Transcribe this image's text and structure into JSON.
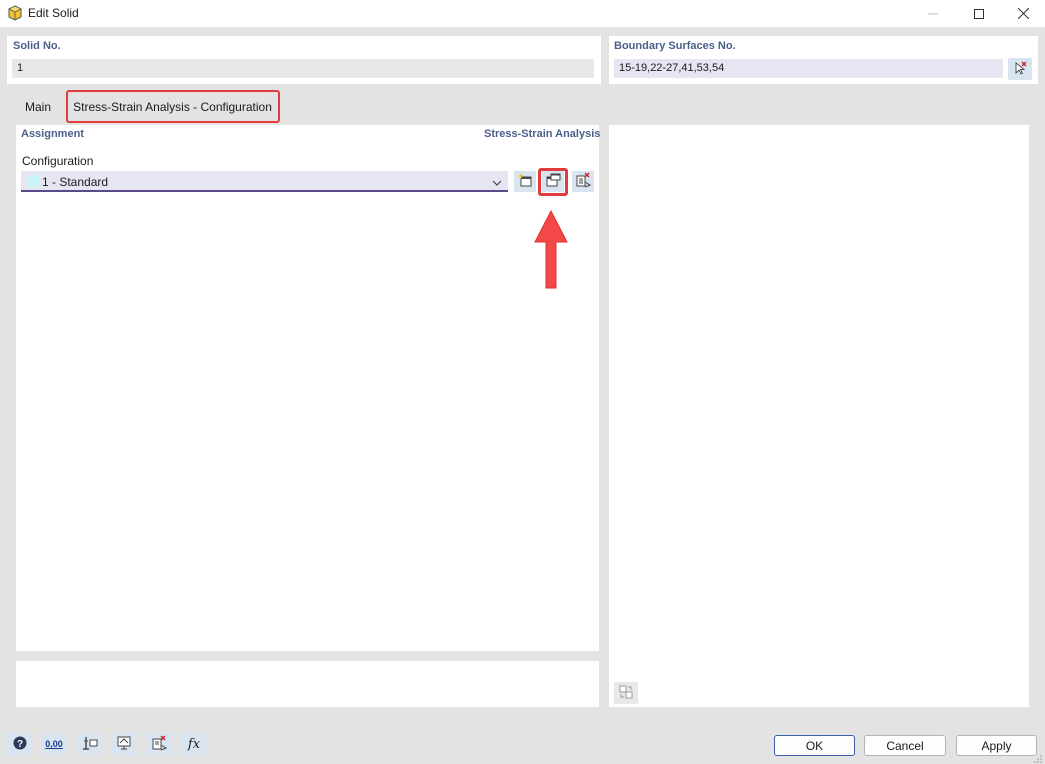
{
  "window": {
    "title": "Edit Solid",
    "app_icon": "cube-app-icon"
  },
  "solid": {
    "label": "Solid No.",
    "value": "1"
  },
  "boundary": {
    "label": "Boundary Surfaces No.",
    "value": "15-19,22-27,41,53,54",
    "pick_icon": "pick-cursor-icon"
  },
  "tabs": [
    {
      "label": "Main",
      "active": false
    },
    {
      "label": "Stress-Strain Analysis - Configuration",
      "active": true,
      "highlighted": true
    }
  ],
  "assignment": {
    "left_header": "Assignment",
    "right_header": "Stress-Strain Analysis",
    "config_label": "Configuration",
    "selected_config": "1 - Standard",
    "swatch_color": "#c8f4f8",
    "tool_buttons": [
      "new-config-icon",
      "edit-config-icon",
      "delete-config-icon"
    ],
    "highlighted_button": "edit-config-icon"
  },
  "bottom_toolbar": [
    "help-icon",
    "units-icon",
    "model-icon",
    "display-icon",
    "delete-selection-icon",
    "formula-icon"
  ],
  "units_icon_text": "0,00",
  "formula_icon_text": "fx",
  "buttons": {
    "ok": "OK",
    "cancel": "Cancel",
    "apply": "Apply"
  },
  "colors": {
    "highlight": "#e03c3c",
    "section_label": "#4a5f8a",
    "icon_button_bg": "#d8e4f0"
  }
}
